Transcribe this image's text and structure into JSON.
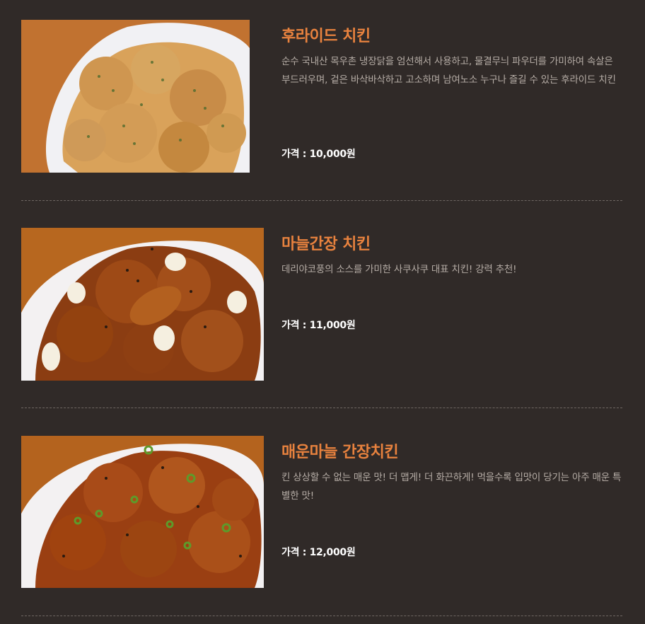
{
  "menu": {
    "items": [
      {
        "name": "후라이드 치킨",
        "description": "순수 국내산 목우촌 냉장닭을 엄선해서 사용하고, 물결무늬 파우더를 가미하여 속살은 부드러우며, 겉은 바삭바삭하고 고소하며 남여노소 누구나 즐길 수 있는 후라이드 치킨",
        "price": "가격 : 10,000원",
        "image": "fried-chicken-photo"
      },
      {
        "name": "마늘간장 치킨",
        "description": "데리야코풍의 소스를 가미한 사쿠사쿠 대표 치킨! 강력 추천!",
        "price": "가격 : 11,000원",
        "image": "garlic-soy-chicken-photo"
      },
      {
        "name": "매운마늘 간장치킨",
        "description": "킨 상상할 수 없는 매운 맛! 더 맵게! 더 화끈하게! 먹을수록 입맛이 당기는 아주 매운 특별한 맛!",
        "price": "가격 : 12,000원",
        "image": "spicy-garlic-soy-chicken-photo"
      }
    ]
  },
  "colors": {
    "background": "#302a28",
    "title": "#e8823e",
    "description": "#b6ada6",
    "price": "#ffffff",
    "divider": "#6e6762"
  }
}
